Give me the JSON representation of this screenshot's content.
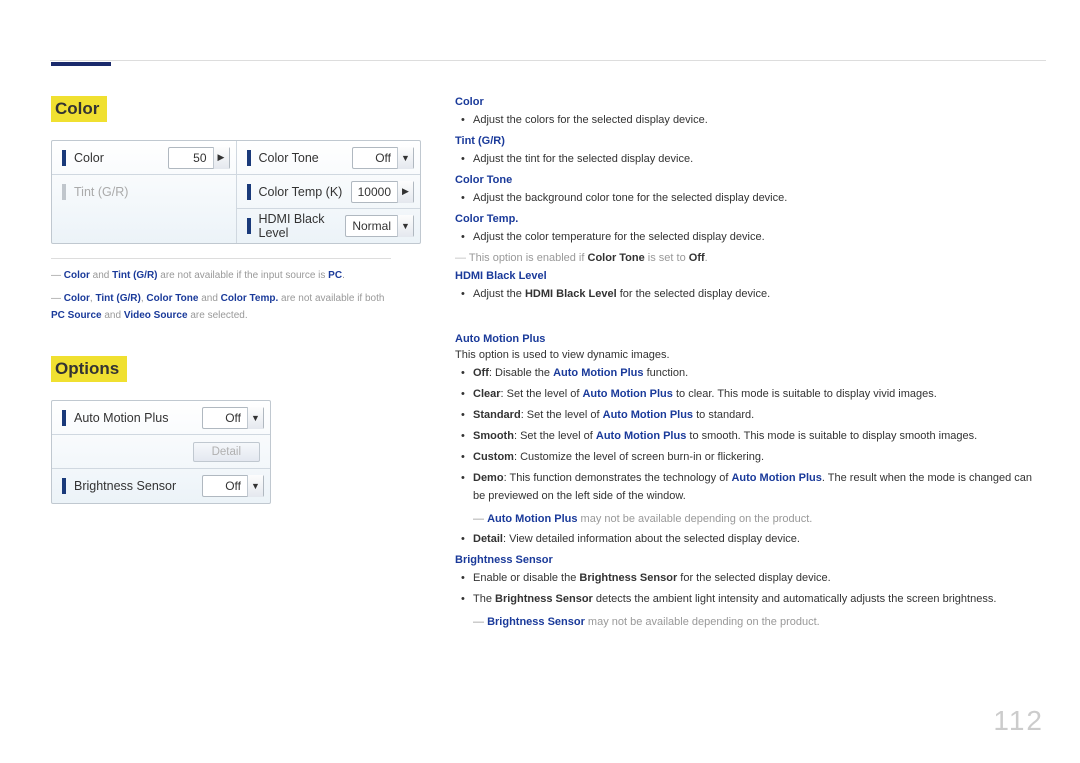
{
  "page_number": "112",
  "left": {
    "color_section": {
      "title": "Color",
      "controls": {
        "color": {
          "label": "Color",
          "value": "50"
        },
        "tint": {
          "label": "Tint (G/R)",
          "value": ""
        },
        "color_tone": {
          "label": "Color Tone",
          "value": "Off"
        },
        "color_temp_k": {
          "label": "Color Temp (K)",
          "value": "10000"
        },
        "hdmi_black": {
          "label": "HDMI Black Level",
          "value": "Normal"
        }
      },
      "footnotes": {
        "fn1_a": "Color",
        "fn1_b": " and ",
        "fn1_c": "Tint (G/R)",
        "fn1_d": " are not available if the input source is ",
        "fn1_e": "PC",
        "fn1_f": ".",
        "fn2_a": "Color",
        "fn2_b": ", ",
        "fn2_c": "Tint (G/R)",
        "fn2_d": ", ",
        "fn2_e": "Color Tone",
        "fn2_f": " and ",
        "fn2_g": "Color Temp.",
        "fn2_h": " are not available if both ",
        "fn2_i": "PC Source",
        "fn2_j": " and ",
        "fn2_k": "Video Source",
        "fn2_l": " are selected."
      }
    },
    "options_section": {
      "title": "Options",
      "controls": {
        "amp": {
          "label": "Auto Motion Plus",
          "value": "Off"
        },
        "detail": {
          "label": "Detail"
        },
        "bs": {
          "label": "Brightness Sensor",
          "value": "Off"
        }
      }
    }
  },
  "right": {
    "color": {
      "h": "Color",
      "t": "Adjust the colors for the selected display device."
    },
    "tint": {
      "h": "Tint (G/R)",
      "t": "Adjust the tint for the selected display device."
    },
    "ctone": {
      "h": "Color Tone",
      "t": "Adjust the background color tone for the selected display device."
    },
    "ctemp": {
      "h": "Color Temp.",
      "t": "Adjust the color temperature for the selected display device.",
      "note_a": "This option is enabled if ",
      "note_b": "Color Tone",
      "note_c": " is set to ",
      "note_d": "Off",
      "note_e": "."
    },
    "hdmi": {
      "h": "HDMI Black Level",
      "t1a": "Adjust the ",
      "t1b": "HDMI Black Level",
      "t1c": " for the selected display device."
    },
    "amp": {
      "h": "Auto Motion Plus",
      "intro": "This option is used to view dynamic images.",
      "off_a": "Off",
      "off_b": ": Disable the ",
      "off_c": "Auto Motion Plus",
      "off_d": " function.",
      "clear_a": "Clear",
      "clear_b": ": Set the level of ",
      "clear_c": "Auto Motion Plus",
      "clear_d": " to clear. This mode is suitable to display vivid images.",
      "std_a": "Standard",
      "std_b": ": Set the level of ",
      "std_c": "Auto Motion Plus",
      "std_d": " to standard.",
      "smooth_a": "Smooth",
      "smooth_b": ": Set the level of ",
      "smooth_c": "Auto Motion Plus",
      "smooth_d": " to smooth. This mode is suitable to display smooth images.",
      "custom_a": "Custom",
      "custom_b": ": Customize the level of screen burn-in or flickering.",
      "demo_a": "Demo",
      "demo_b": ": This function demonstrates the technology of ",
      "demo_c": "Auto Motion Plus",
      "demo_d": ". The result when the mode is changed can be previewed on the left side of the window.",
      "note_a": "Auto Motion Plus",
      "note_b": " may not be available depending on the product.",
      "detail_a": "Detail",
      "detail_b": ": View detailed information about the selected display device."
    },
    "bs": {
      "h": "Brightness Sensor",
      "t1a": "Enable or disable the ",
      "t1b": "Brightness Sensor",
      "t1c": " for the selected display device.",
      "t2a": "The ",
      "t2b": "Brightness Sensor",
      "t2c": " detects the ambient light intensity and automatically adjusts the screen brightness.",
      "note_a": "Brightness Sensor",
      "note_b": " may not be available depending on the product."
    }
  }
}
